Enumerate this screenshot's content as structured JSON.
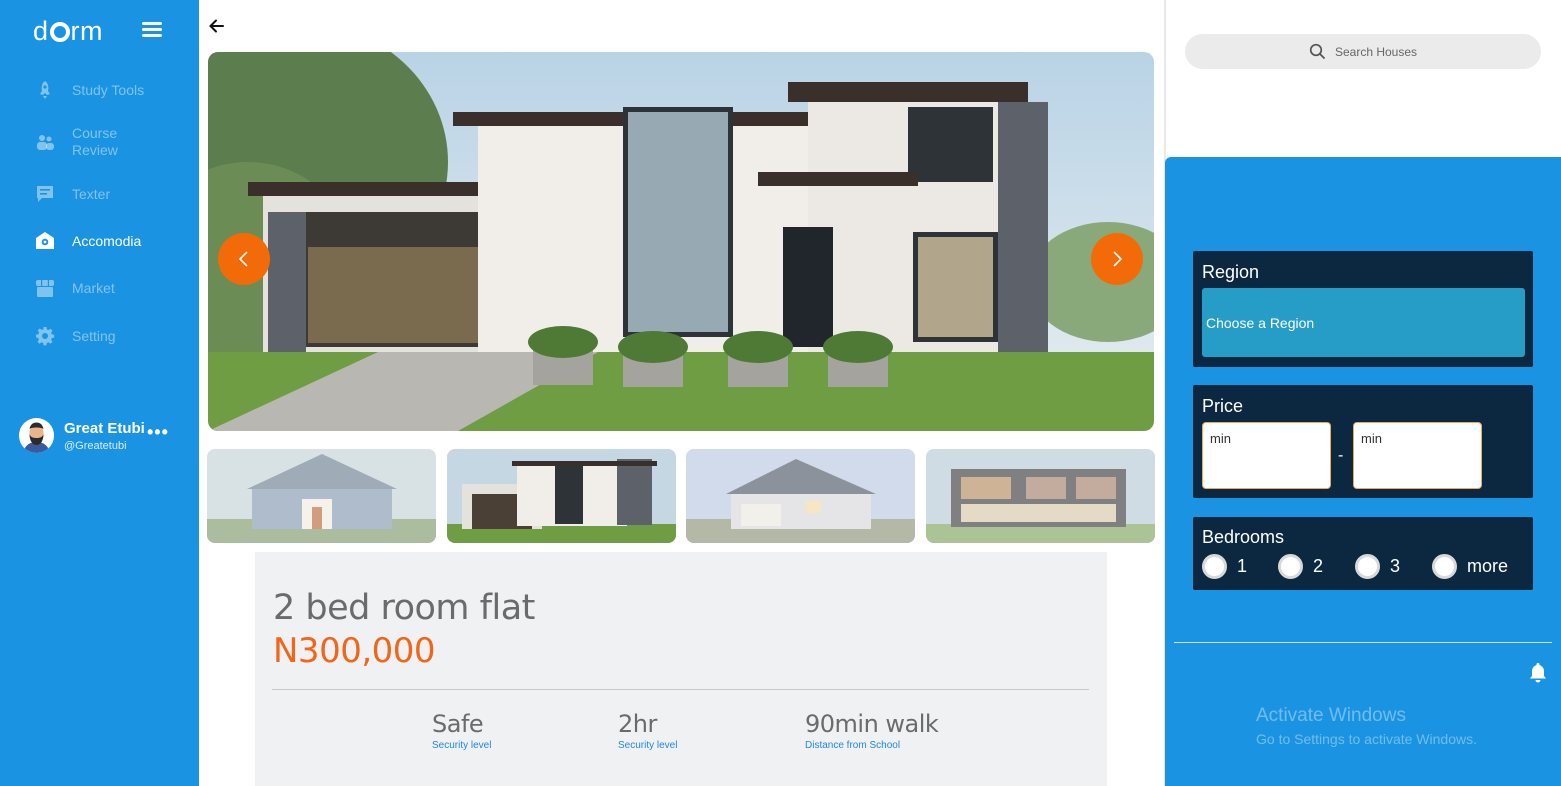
{
  "brand": {
    "logo_left": "d",
    "logo_right": "rm"
  },
  "sidebar": {
    "items": [
      {
        "label": "Study Tools",
        "icon": "rocket-icon",
        "active": false
      },
      {
        "label": "Course\nReview",
        "icon": "people-icon",
        "active": false
      },
      {
        "label": "Texter",
        "icon": "chat-icon",
        "active": false
      },
      {
        "label": "Accomodia",
        "icon": "home-icon",
        "active": true
      },
      {
        "label": "Market",
        "icon": "store-icon",
        "active": false
      },
      {
        "label": "Setting",
        "icon": "gear-icon",
        "active": false
      }
    ]
  },
  "profile": {
    "name": "Great Etubi",
    "handle": "@Greatetubi",
    "more": "•••"
  },
  "listing": {
    "title": "2 bed room flat",
    "price": "N300,000",
    "stats": [
      {
        "value": "Safe",
        "label": "Security level"
      },
      {
        "value": "2hr",
        "label": "Security level"
      },
      {
        "value": "90min walk",
        "label": "Distance from School"
      }
    ]
  },
  "search": {
    "placeholder": "Search Houses"
  },
  "filters": {
    "region": {
      "label": "Region",
      "placeholder": "Choose a Region"
    },
    "price": {
      "label": "Price",
      "min1": "min",
      "min2": "min",
      "separator": "-"
    },
    "bedrooms": {
      "label": "Bedrooms",
      "options": [
        "1",
        "2",
        "3",
        "more"
      ]
    }
  },
  "watermark": {
    "title": "Activate Windows",
    "subtitle": "Go to Settings to activate Windows."
  },
  "colors": {
    "primary": "#1a93e2",
    "accent": "#f36b08",
    "dark": "#0b2840",
    "region": "#259dc7"
  }
}
